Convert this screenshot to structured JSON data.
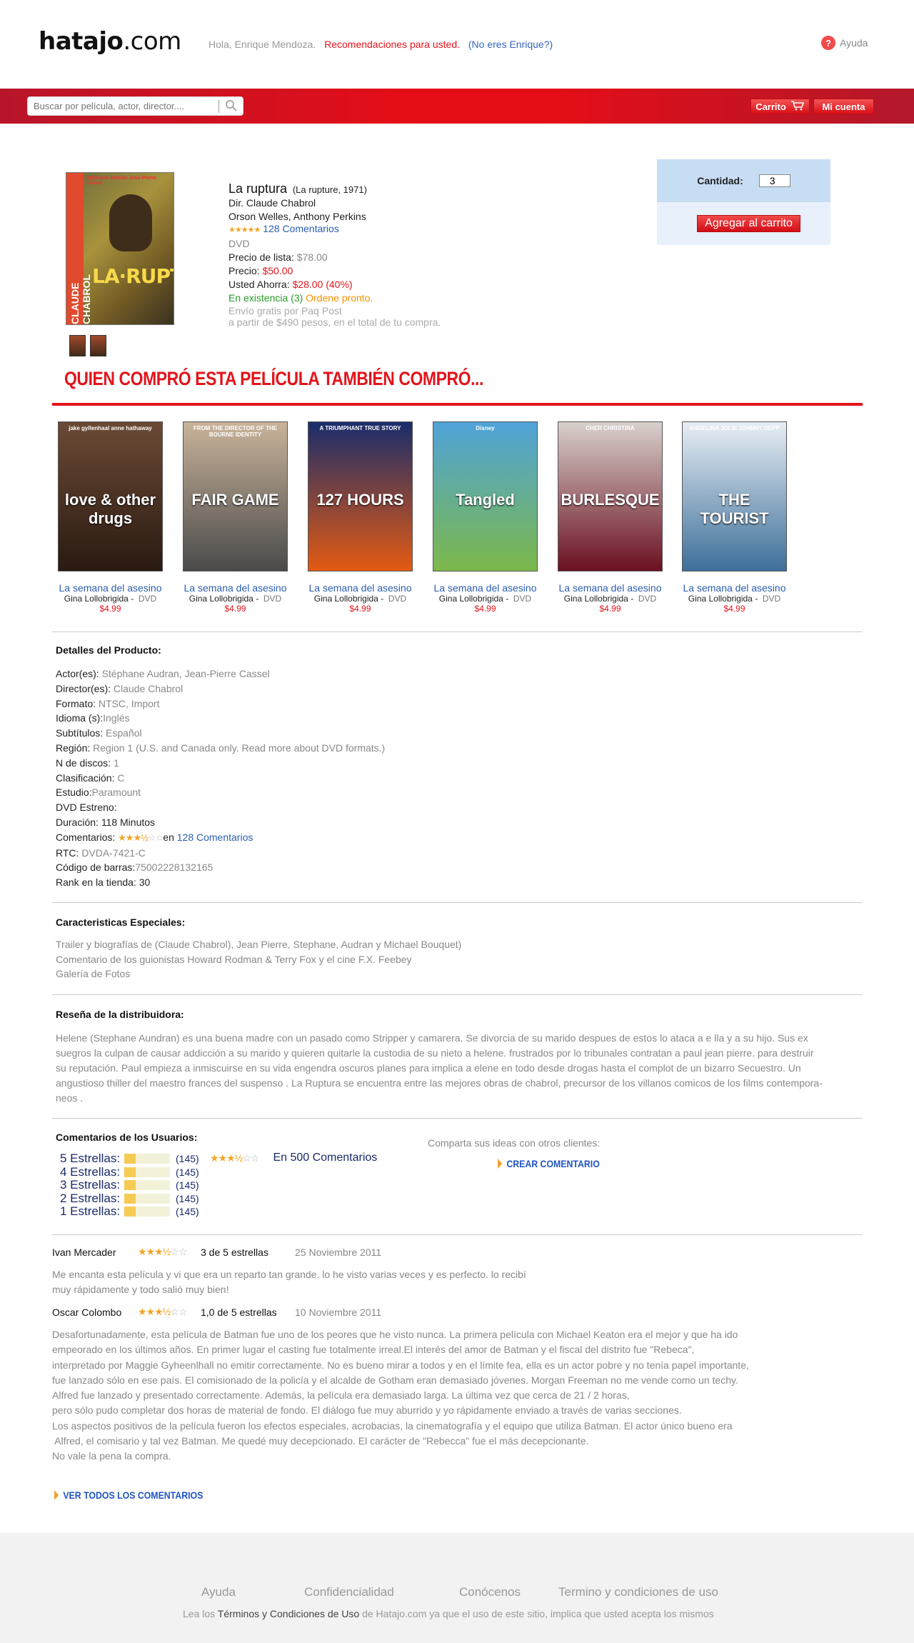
{
  "header": {
    "logo_main": "hatajo",
    "logo_tld": ".com",
    "greeting": "Hola, Enrique Mendoza.",
    "recommendations": "Recomendaciones para usted.",
    "not_you": "(No eres Enrique?)",
    "help": "Ayuda"
  },
  "navbar": {
    "search_placeholder": "Buscar por película, actor, director....",
    "cart": "Carrito",
    "account": "Mi cuenta"
  },
  "product": {
    "title": "La ruptura",
    "original": "(La rupture, 1971)",
    "director": "Dir. Claude Chabrol",
    "cast": "Orson Welles, Anthony Perkins",
    "reviews_link": "128 Comentarios",
    "format": "DVD",
    "list_price_label": "Precio de lista:",
    "list_price": "$78.00",
    "price_label": "Precio:",
    "price": "$50.00",
    "savings_label": "Usted Ahorra:",
    "savings": "$28.00 (40%)",
    "stock": "En existencia (3)",
    "order_now": "Ordene pronto.",
    "shipping1": "Envío gratis por Paq Post",
    "shipping2": "a partir de $490 pesos, en el total de tu compra.",
    "rating": 5,
    "cover": {
      "top_text": "Stéphane Audran    Jean-Pierre Cassel",
      "side_text": "CLAUDE CHABROL",
      "title_text": "LA·RUPTURA"
    }
  },
  "cart_box": {
    "qty_label": "Cantidad:",
    "qty_value": "3",
    "add_button": "Agregar al carrito"
  },
  "also_bought": {
    "heading": "QUIEN COMPRÓ ESTA PELÍCULA TAMBIÉN COMPRÓ...",
    "items": [
      {
        "name": "La semana del asesino",
        "actor": "Gina Lollobrigida -",
        "format": "DVD",
        "price": "$4.99",
        "poster": "love & other drugs",
        "top": "jake gyllenhaal    anne hathaway",
        "color1": "#6b4a35",
        "color2": "#2a1a12"
      },
      {
        "name": "La semana del asesino",
        "actor": "Gina Lollobrigida -",
        "format": "DVD",
        "price": "$4.99",
        "poster": "FAIR GAME",
        "top": "FROM THE DIRECTOR OF THE BOURNE IDENTITY",
        "color1": "#c9b39a",
        "color2": "#4a4a4a"
      },
      {
        "name": "La semana del asesino",
        "actor": "Gina Lollobrigida -",
        "format": "DVD",
        "price": "$4.99",
        "poster": "127 HOURS",
        "top": "A TRIUMPHANT TRUE STORY",
        "color1": "#1a2d6b",
        "color2": "#e35a12"
      },
      {
        "name": "La semana del asesino",
        "actor": "Gina Lollobrigida -",
        "format": "DVD",
        "price": "$4.99",
        "poster": "Tangled",
        "top": "Disney",
        "color1": "#4fa3d9",
        "color2": "#7cb84a"
      },
      {
        "name": "La semana del asesino",
        "actor": "Gina Lollobrigida -",
        "format": "DVD",
        "price": "$4.99",
        "poster": "BURLESQUE",
        "top": "CHER    CHRISTINA",
        "color1": "#d8d0cc",
        "color2": "#6a1020"
      },
      {
        "name": "La semana del asesino",
        "actor": "Gina Lollobrigida -",
        "format": "DVD",
        "price": "$4.99",
        "poster": "THE TOURIST",
        "top": "ANGELINA JOLIE    JOHNNY DEPP",
        "color1": "#e8eef4",
        "color2": "#3d6f9a"
      }
    ]
  },
  "details": {
    "heading": "Detalles del Producto:",
    "rows": [
      {
        "label": "Actor(es)",
        "sep": ": ",
        "value": "Stéphane Audran, Jean-Pierre Cassel"
      },
      {
        "label": "Director(es)",
        "sep": ": ",
        "value": "Claude Chabrol"
      },
      {
        "label": "Formato",
        "sep": ": ",
        "value": "NTSC, Import"
      },
      {
        "label": "Idioma (s)",
        "sep": ":",
        "value": "Inglés"
      },
      {
        "label": "Subtítulos",
        "sep": ": ",
        "value": "Español"
      },
      {
        "label": "Región",
        "sep": ": ",
        "value": "Region 1  (U.S. and Canada only. Read more about DVD formats.)"
      },
      {
        "label": "N de discos",
        "sep": ": ",
        "value": "1"
      },
      {
        "label": "Clasificación",
        "sep": ": ",
        "value": "C"
      },
      {
        "label": "Estudio",
        "sep": ":",
        "value": "Paramount"
      },
      {
        "label": "DVD Estreno",
        "sep": ":",
        "value": ""
      },
      {
        "label": "Duración",
        "sep": ": ",
        "value": "118 Minutos",
        "dark": true
      }
    ],
    "comments_label": "Comentarios:",
    "comments_en": "en",
    "comments_link": "128 Comentarios",
    "comments_rating": 3.5,
    "rtc_label": "RTC:",
    "rtc_value": "DVDA-7421-C",
    "barcode_label": "Código de barras:",
    "barcode_value": "75002228132165",
    "rank_label": "Rank en la tienda:",
    "rank_value": "30"
  },
  "features": {
    "heading": "Caracteristicas Especiales:",
    "lines": [
      "Trailer y biografías de (Claude Chabrol), Jean Pierre, Stephane, Audran y Michael  Bouquet)",
      "Comentario de los guionistas Howard Rodman & Terry Fox y el cine F.X. Feebey",
      "Galería de Fotos"
    ]
  },
  "distributor": {
    "heading": "Reseña de la distribuidora:",
    "lines": [
      "Helene (Stephane Aundran) es una buena  madre  con un pasado como Stripper y camarera. Se divorcia de su marido  despues de estos lo ataca a  e lla  y a  su hijo. Sus  ex",
      "suegros la culpan  de causar addicción a su marido  y quieren quitarle la custodia de su nieto a helene. frustrados por lo tribunales  contratan a paul jean pierre. para  destruir",
      "su reputación. Paul  empieza a inmiscuirse en su vida  engendra oscuros  planes  para implica a elene en todo desde drogas hasta el complot de un bizarro Secuestro. Un",
      "angustioso thiller del maestro frances del suspenso . La  Ruptura  se encuentra entre las mejores obras de chabrol, precursor de los villanos comicos  de los films contempora-",
      "neos ."
    ]
  },
  "user_reviews": {
    "heading": "Comentarios de los Usuarios:",
    "rows": [
      {
        "label": "5 Estrellas:",
        "count": "(145)",
        "fill": 0.25
      },
      {
        "label": "4 Estrellas:",
        "count": "(145)",
        "fill": 0.25
      },
      {
        "label": "3 Estrellas:",
        "count": "(145)",
        "fill": 0.25
      },
      {
        "label": "2 Estrellas:",
        "count": "(145)",
        "fill": 0.25
      },
      {
        "label": "1 Estrellas:",
        "count": "(145)",
        "fill": 0.25
      }
    ],
    "avg_rating": 3.5,
    "total": "En 500 Comentarios",
    "share": "Comparta sus ideas con otros clientes:",
    "create": "CREAR COMENTARIO"
  },
  "reviews": [
    {
      "author": "Ivan Mercader",
      "rating": 3.5,
      "score": "3 de 5 estrellas",
      "date": "25 Noviembre 2011",
      "lines": [
        "Me encanta esta película y vi que era un reparto tan grande. lo he visto varias veces y es perfecto. lo recibí",
        "muy rápidamente y todo salió muy bien!"
      ]
    },
    {
      "author": "Oscar Colombo",
      "rating": 3.5,
      "score": "1,0 de 5 estrellas",
      "date": "10 Noviembre 2011",
      "lines": [
        "Desafortunadamente, esta película de Batman fue uno de los peores que he visto nunca. La primera película con Michael Keaton era el mejor y que ha ido",
        "empeorado en los últimos años. En primer lugar el casting fue totalmente irreal.El interés del amor de Batman y el fiscal del distrito fue \"Rebeca\",",
        "interpretado por Maggie Gyheenlhall no emitir correctamente. No es bueno mirar a todos y en el límite fea, ella es un actor pobre y no tenía papel importante,",
        "fue lanzado sólo en ese país. El comisionado de la policía y el alcalde de Gotham eran demasiado jóvenes. Morgan Freeman no me vende como un techy.",
        "Alfred fue lanzado y presentado correctamente. Además, la película era demasiado larga. La última vez que cerca de 21 / 2 horas,",
        "pero sólo pudo completar dos horas de material de fondo. El diálogo fue muy aburrido y yo rápidamente enviado a través de varias secciones.",
        "Los aspectos positivos de la película fueron los efectos especiales, acrobacias, la cinematografía y el equipo que utiliza Batman. El actor único bueno era",
        " Alfred, el comisario y tal vez Batman. Me quedé muy decepcionado. El carácter de \"Rebecca\" fue el más decepcionante.",
        "No vale la pena la compra."
      ]
    }
  ],
  "see_all": "VER TODOS LOS COMENTARIOS",
  "footer": {
    "links": [
      "Ayuda",
      "Confidencialidad",
      "Conócenos",
      "Termino y condiciones de uso"
    ],
    "legal_pre": "Lea los ",
    "legal_bold": "Términos y Condiciones de Uso",
    "legal_post": " de Hatajo.com ya que el uso de este sitio, implica que usted acepta los mismos"
  },
  "colors": {
    "brand_red": "#e3141b",
    "link_blue": "#2a5db0",
    "star_gold": "#f3a524",
    "cart_box_bg": "#c6ddf4"
  }
}
